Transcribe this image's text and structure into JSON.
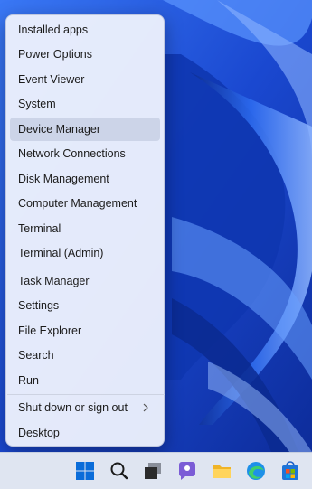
{
  "menu": {
    "items": [
      {
        "label": "Installed apps"
      },
      {
        "label": "Power Options"
      },
      {
        "label": "Event Viewer"
      },
      {
        "label": "System"
      },
      {
        "label": "Device Manager"
      },
      {
        "label": "Network Connections"
      },
      {
        "label": "Disk Management"
      },
      {
        "label": "Computer Management"
      },
      {
        "label": "Terminal"
      },
      {
        "label": "Terminal (Admin)"
      },
      {
        "label": "Task Manager"
      },
      {
        "label": "Settings"
      },
      {
        "label": "File Explorer"
      },
      {
        "label": "Search"
      },
      {
        "label": "Run"
      },
      {
        "label": "Shut down or sign out",
        "submenu_icon": "chevron-right-icon"
      },
      {
        "label": "Desktop"
      }
    ],
    "highlighted_item": "Device Manager"
  },
  "taskbar": {
    "icons": [
      "windows-start-icon",
      "search-icon",
      "task-view-icon",
      "chat-icon",
      "file-explorer-icon",
      "edge-browser-icon",
      "microsoft-store-icon"
    ]
  },
  "colors": {
    "wallpaper_blue": "#1d4fd6",
    "menu_background": "#ecf0fc",
    "highlight": "#c8d0e4",
    "taskbar": "#dfe5f1",
    "start_blue": "#0a6cd9"
  }
}
